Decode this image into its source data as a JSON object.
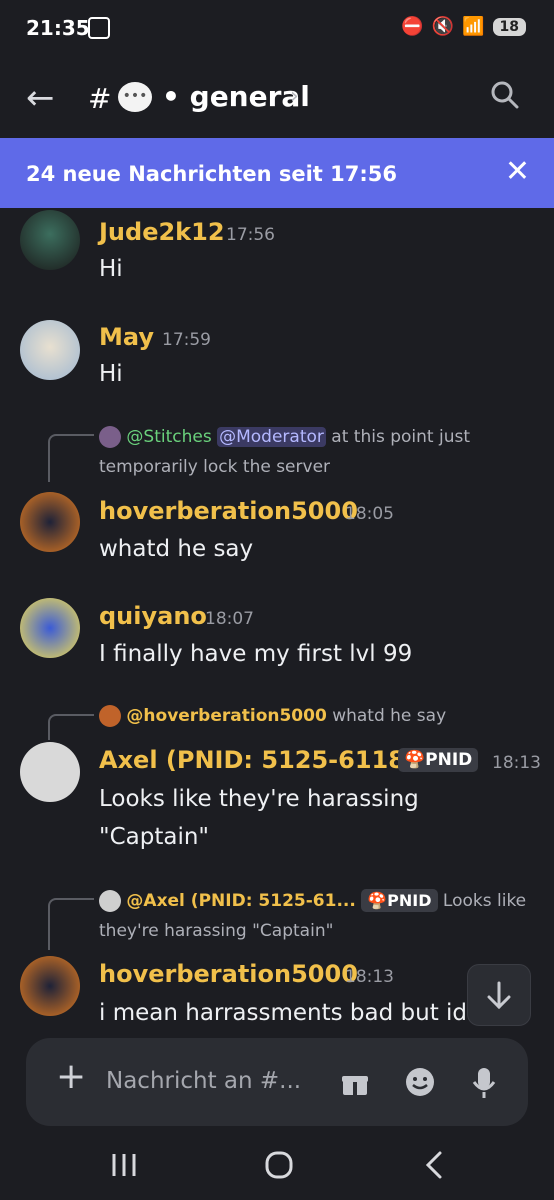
{
  "status_bar": {
    "time": "21:35",
    "battery": "18"
  },
  "header": {
    "hash": "#",
    "channel_emoji": "💬",
    "channel_name": "• general",
    "chevron": "›"
  },
  "banner": {
    "text": "24 neue Nachrichten seit 17:56",
    "close": "✕"
  },
  "messages": [
    {
      "author": "Jude2k12",
      "time": "17:56",
      "text": "Hi"
    },
    {
      "author": "May",
      "time": "17:59",
      "text": "Hi"
    },
    {
      "reply": {
        "mention1": "@Stitches",
        "mention2": "@Moderator",
        "text1": "at this point just",
        "text2": "temporarily lock the server"
      },
      "author": "hoverberation5000",
      "time": "18:05",
      "text": "whatd he say"
    },
    {
      "author": "quiyano",
      "time": "18:07",
      "text": "I finally have my first lvl 99"
    },
    {
      "reply": {
        "mention1": "@hoverberation5000",
        "text1": "whatd he say"
      },
      "author": "Axel (PNID: 5125-6118...",
      "tag": "PNID",
      "time": "18:13",
      "text1": "Looks like they're harassing",
      "text2": "\"Captain\""
    },
    {
      "reply": {
        "mention1": "@Axel (PNID: 5125-61...",
        "tag": "PNID",
        "text1": "Looks like",
        "text2": "they're harassing \"Captain\""
      },
      "author": "hoverberation5000",
      "time": "18:13",
      "text": "i mean harrassments bad but id"
    }
  ],
  "composer": {
    "placeholder": "Nachricht an #..."
  },
  "icons": [
    "back-arrow-icon",
    "search-icon",
    "close-icon",
    "chevron-down-icon",
    "plus-icon",
    "gift-icon",
    "emoji-icon",
    "mic-icon"
  ]
}
